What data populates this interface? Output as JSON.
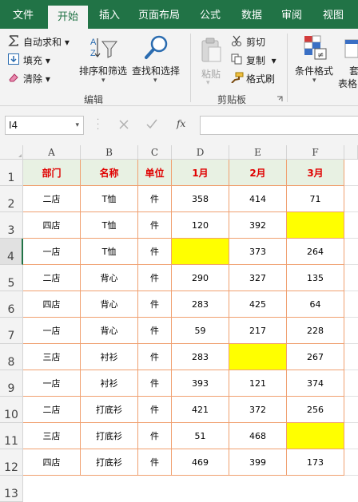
{
  "ribbon_tabs": [
    {
      "label": "文件",
      "active": false
    },
    {
      "label": "开始",
      "active": true
    },
    {
      "label": "插入",
      "active": false
    },
    {
      "label": "页面布局",
      "active": false
    },
    {
      "label": "公式",
      "active": false
    },
    {
      "label": "数据",
      "active": false
    },
    {
      "label": "审阅",
      "active": false
    },
    {
      "label": "视图",
      "active": false
    }
  ],
  "editing": {
    "autosum": "自动求和",
    "fill": "填充",
    "clear": "清除",
    "sort_filter": "排序和筛选",
    "find_select": "查找和选择",
    "group_label": "编辑"
  },
  "clipboard": {
    "paste": "粘贴",
    "cut": "剪切",
    "copy": "复制",
    "format_painter": "格式刷",
    "group_label": "剪贴板"
  },
  "styles": {
    "conditional_formatting": "条件格式",
    "table_format_partial1": "套",
    "table_format_partial2": "表格"
  },
  "formula_bar": {
    "name_box": "I4",
    "fx_label": "fx",
    "value": ""
  },
  "colors": {
    "ribbon_green": "#217346",
    "header_fill": "#e8f1e3",
    "header_text": "#e00000",
    "highlight": "#ffff00",
    "border": "#f0a070"
  },
  "sheet": {
    "columns": [
      "A",
      "B",
      "C",
      "D",
      "E",
      "F"
    ],
    "row_numbers": [
      "1",
      "2",
      "3",
      "4",
      "5",
      "6",
      "7",
      "8",
      "9",
      "10",
      "11",
      "12",
      "13"
    ],
    "selected_row": "4",
    "header": [
      "部门",
      "名称",
      "单位",
      "1月",
      "2月",
      "3月"
    ],
    "rows": [
      [
        "二店",
        "T恤",
        "件",
        "358",
        "414",
        "71"
      ],
      [
        "四店",
        "T恤",
        "件",
        "120",
        "392",
        ""
      ],
      [
        "一店",
        "T恤",
        "件",
        "",
        "373",
        "264"
      ],
      [
        "二店",
        "背心",
        "件",
        "290",
        "327",
        "135"
      ],
      [
        "四店",
        "背心",
        "件",
        "283",
        "425",
        "64"
      ],
      [
        "一店",
        "背心",
        "件",
        "59",
        "217",
        "228"
      ],
      [
        "三店",
        "衬衫",
        "件",
        "283",
        "",
        "267"
      ],
      [
        "一店",
        "衬衫",
        "件",
        "393",
        "121",
        "374"
      ],
      [
        "二店",
        "打底衫",
        "件",
        "421",
        "372",
        "256"
      ],
      [
        "三店",
        "打底衫",
        "件",
        "51",
        "468",
        ""
      ],
      [
        "四店",
        "打底衫",
        "件",
        "469",
        "399",
        "173"
      ]
    ],
    "yellow_cells": [
      [
        1,
        5
      ],
      [
        2,
        3
      ],
      [
        6,
        4
      ],
      [
        9,
        5
      ]
    ]
  }
}
